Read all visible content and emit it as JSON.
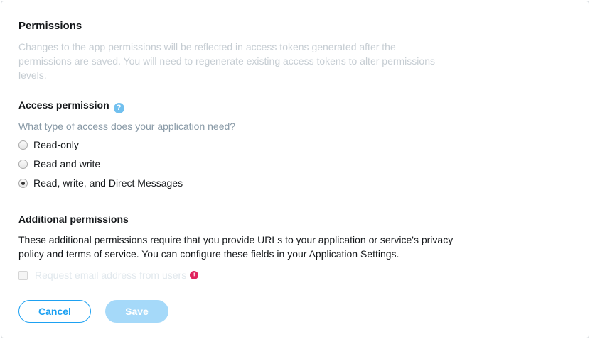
{
  "permissions": {
    "title": "Permissions",
    "description": "Changes to the app permissions will be reflected in access tokens generated after the permissions are saved. You will need to regenerate existing access tokens to alter permissions levels."
  },
  "access": {
    "title": "Access permission",
    "help_icon": "question-mark-icon",
    "question": "What type of access does your application need?",
    "options": [
      {
        "label": "Read-only",
        "checked": false
      },
      {
        "label": "Read and write",
        "checked": false
      },
      {
        "label": "Read, write, and Direct Messages",
        "checked": true
      }
    ]
  },
  "additional": {
    "title": "Additional permissions",
    "description": "These additional permissions require that you provide URLs to your application or service's privacy policy and terms of service. You can configure these fields in your Application Settings.",
    "email_checkbox_label": "Request email address from users",
    "email_checkbox_checked": false,
    "warning_icon": "exclamation-icon"
  },
  "buttons": {
    "cancel": "Cancel",
    "save": "Save"
  },
  "colors": {
    "accent": "#1da1f2",
    "save_disabled": "#a5d9f9",
    "warning": "#e0245e",
    "help": "#71c0ef"
  }
}
